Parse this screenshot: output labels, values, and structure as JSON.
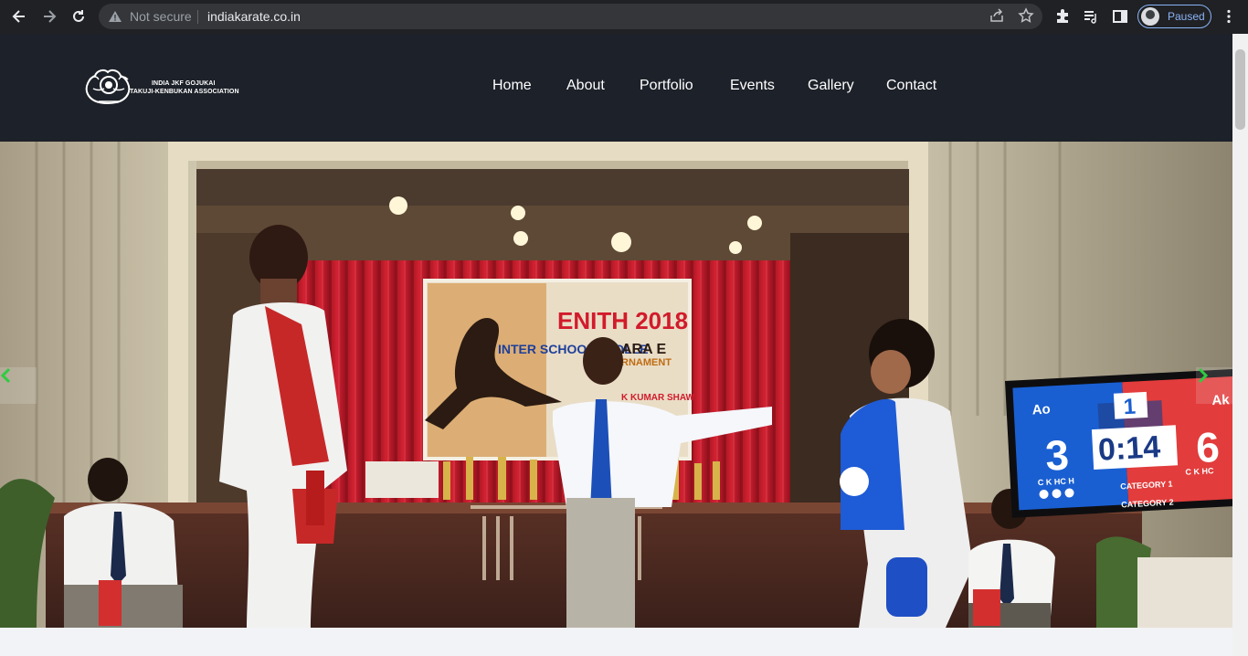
{
  "browser": {
    "security_label": "Not secure",
    "url": "indiakarate.co.in",
    "profile_status": "Paused",
    "icons": [
      "back-icon",
      "forward-icon",
      "reload-icon",
      "warning-icon",
      "share-icon",
      "star-icon",
      "extensions-icon",
      "reading-list-icon",
      "side-panel-icon",
      "menu-icon"
    ]
  },
  "site": {
    "logo_line1": "INDIA JKF GOJUKAI",
    "logo_line2": "TAKUJI-KENBUKAN ASSOCIATION",
    "nav": [
      {
        "label": "Home"
      },
      {
        "label": "About"
      },
      {
        "label": "Portfolio"
      },
      {
        "label": "Events"
      },
      {
        "label": "Gallery"
      },
      {
        "label": "Contact"
      }
    ]
  },
  "hero": {
    "banner": {
      "title": "ENITH 2018",
      "subtitle": "INTER SCHOOL / COLLE",
      "tag": "ARA E",
      "sub2": "RNAMENT",
      "footer": "K KUMAR SHAW"
    },
    "scoreboard": {
      "left_label": "Ao",
      "right_label": "Ak",
      "left_score": "3",
      "right_score": "6",
      "round": "1",
      "timer": "0:14",
      "category1": "CATEGORY 1",
      "category2": "CATEGORY 2",
      "penalty_labels": "C K HC H",
      "penalty_labels_right": "C K HC"
    },
    "colors": {
      "curtain": "#c4202e",
      "scoreboard_blue": "#1a5fd1",
      "scoreboard_red": "#e23c3c",
      "arrow": "#2ecc40"
    }
  }
}
